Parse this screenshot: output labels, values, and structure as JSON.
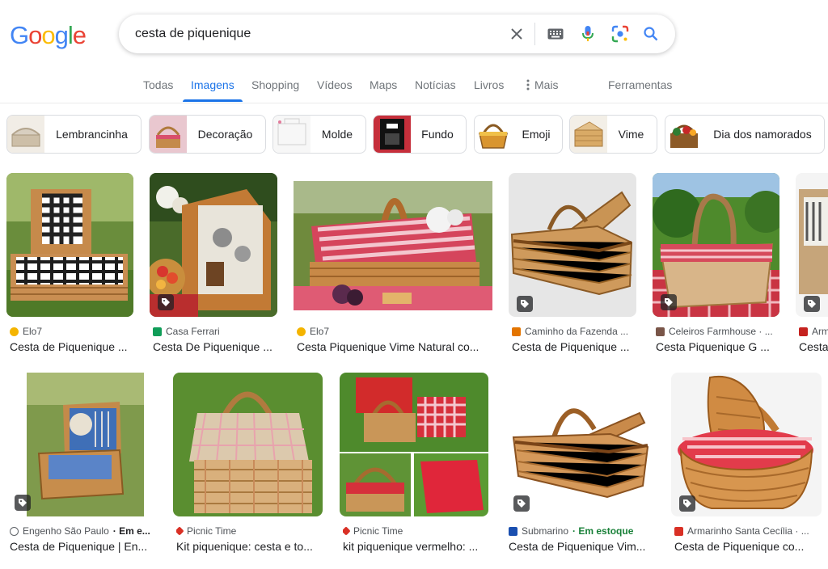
{
  "header": {
    "logo": [
      "G",
      "o",
      "o",
      "g",
      "l",
      "e"
    ],
    "logo_colors": [
      "#4285f4",
      "#ea4335",
      "#fbbc05",
      "#4285f4",
      "#34a853",
      "#ea4335"
    ],
    "query": "cesta de piquenique",
    "icons": [
      "close-icon",
      "keyboard-icon",
      "microphone-icon",
      "lens-icon",
      "search-icon"
    ]
  },
  "tabs": {
    "items": [
      "Todas",
      "Imagens",
      "Shopping",
      "Vídeos",
      "Maps",
      "Notícias",
      "Livros",
      "Mais",
      "Ferramentas"
    ],
    "active": "Imagens",
    "accent": "#1a73e8"
  },
  "chips": [
    "Lembrancinha",
    "Decoração",
    "Molde",
    "Fundo",
    "Emoji",
    "Vime",
    "Dia dos namorados"
  ],
  "results": {
    "row1": [
      {
        "source": "Elo7",
        "title": "Cesta de Piquenique ...",
        "favicon": "#f4b400",
        "tag": false
      },
      {
        "source": "Casa Ferrari",
        "title": "Cesta De Piquenique ...",
        "favicon": "#0f9d58",
        "tag": true
      },
      {
        "source": "Elo7",
        "title": "Cesta Piquenique Vime Natural co...",
        "favicon": "#f4b400",
        "tag": false
      },
      {
        "source": "Caminho da Fazenda ...",
        "title": "Cesta de Piquenique ...",
        "favicon": "#e37400",
        "tag": true
      },
      {
        "source": "Celeiros Farmhouse · ...",
        "title": "Cesta Piquenique G ...",
        "favicon": "#795548",
        "tag": true
      },
      {
        "source": "Arm",
        "title": "Cesta",
        "favicon": "#c5221f",
        "tag": true
      }
    ],
    "row2": [
      {
        "source": "Engenho São Paulo",
        "extra": "· Em e...",
        "title": "Cesta de Piquenique | En...",
        "favicon": "#5f6368",
        "tag": true
      },
      {
        "source": "Picnic Time",
        "title": "Kit piquenique: cesta e to...",
        "favicon": "#d93025",
        "tag": false
      },
      {
        "source": "Picnic Time",
        "title": "kit piquenique vermelho: ...",
        "favicon": "#d93025",
        "tag": false
      },
      {
        "source": "Submarino",
        "extra": "· Em estoque",
        "title": "Cesta de Piquenique Vim...",
        "favicon": "#1a4fb0",
        "tag": true
      },
      {
        "source": "Armarinho Santa Cecília · ...",
        "title": "Cesta de Piquenique co...",
        "favicon": "#d93025",
        "tag": true
      }
    ]
  }
}
